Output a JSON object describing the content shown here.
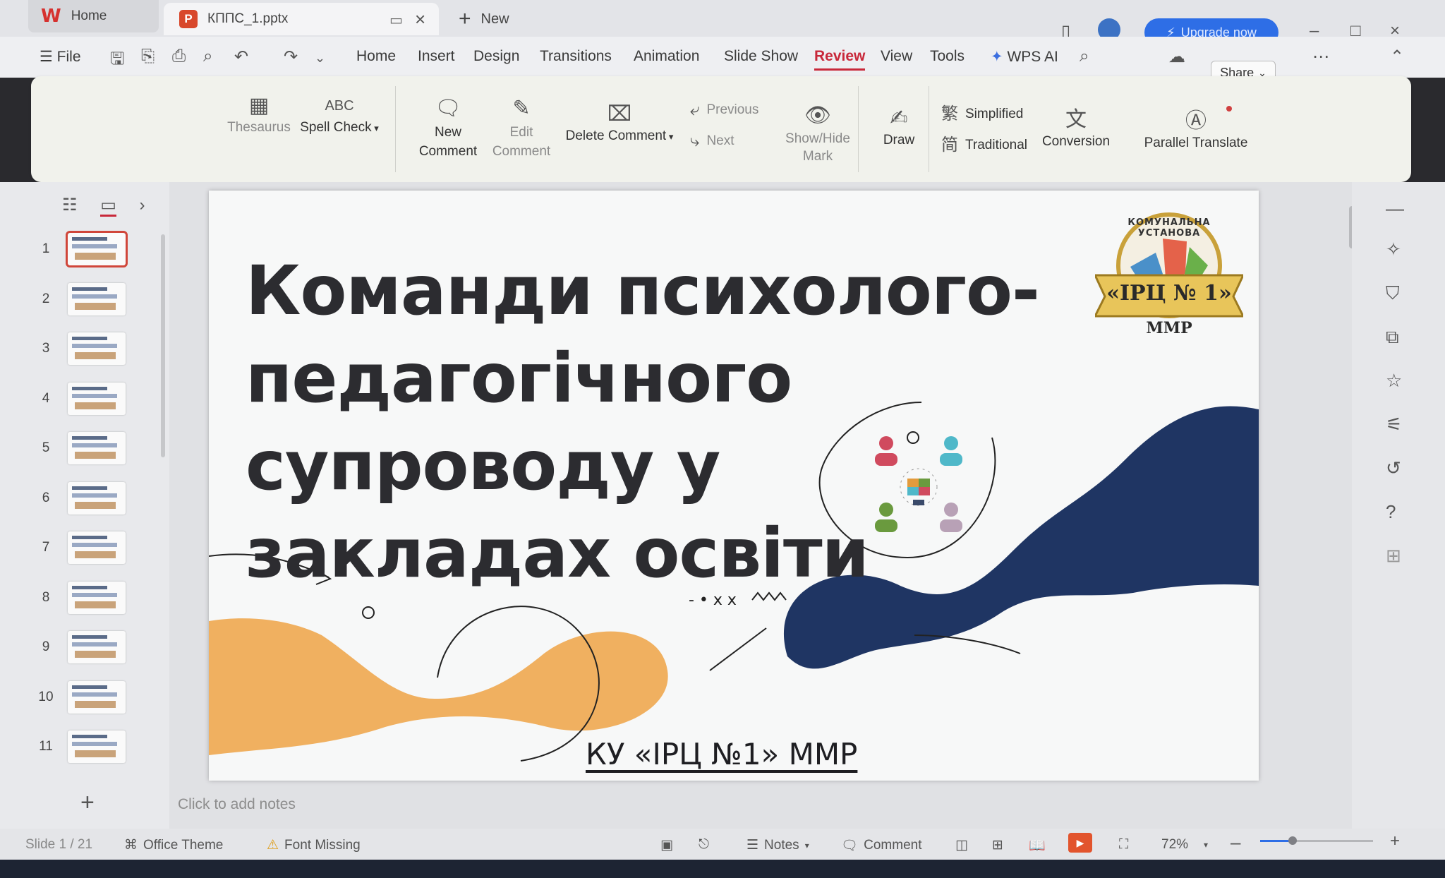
{
  "tabs": {
    "home_label": "Home",
    "doc_label": "КППС_1.pptx",
    "new_label": "New",
    "upgrade_label": "Upgrade now"
  },
  "menu": {
    "file_label": "File",
    "items": [
      "Home",
      "Insert",
      "Design",
      "Transitions",
      "Animation",
      "Slide Show",
      "Review",
      "View",
      "Tools"
    ],
    "active": "Review",
    "wps_ai_label": "WPS AI",
    "share_label": "Share"
  },
  "ribbon": {
    "thesaurus": "Thesaurus",
    "spell_check": "Spell Check",
    "new_comment": [
      "New",
      "Comment"
    ],
    "edit_comment": [
      "Edit",
      "Comment"
    ],
    "delete_comment": "Delete Comment",
    "previous": "Previous",
    "next": "Next",
    "show_hide_mark": [
      "Show/Hide",
      "Mark"
    ],
    "draw": "Draw",
    "simplified": "Simplified",
    "traditional": "Traditional",
    "conversion": "Conversion",
    "parallel_translate": "Parallel Translate",
    "spell_icon_text": "ABC"
  },
  "slides_panel": {
    "numbers": [
      "1",
      "2",
      "3",
      "4",
      "5",
      "6",
      "7",
      "8",
      "9",
      "10",
      "11"
    ],
    "selected": 1
  },
  "slide": {
    "title_lines": [
      "Команди психолого-",
      "педагогічного супроводу у",
      "закладах освіти"
    ],
    "footer": "КУ «ІРЦ №1» ММР",
    "logo_top_text": "КОМУНАЛЬНА УСТАНОВА",
    "logo_center_text": "«ІРЦ № 1»",
    "logo_bottom_text": "ММР",
    "doodle_text": "- • x x",
    "colors": {
      "orange": "#f0b060",
      "navy": "#1f3563",
      "title": "#2c2c30"
    }
  },
  "notes_placeholder": "Click to add notes",
  "status": {
    "slide_counter": "Slide 1 / 21",
    "theme": "Office Theme",
    "font_missing": "Font Missing",
    "notes_label": "Notes",
    "comment_label": "Comment",
    "zoom": "72%",
    "zoom_fraction": 0.29
  },
  "icons": {
    "tab_bar": [
      "wps-logo-icon",
      "ppt-file-icon",
      "monitor-icon",
      "close-icon",
      "plus-icon",
      "tablet-icon",
      "avatar-icon",
      "bolt-icon",
      "minimize-icon",
      "maximize-icon",
      "window-close-icon"
    ],
    "right_sidebar": [
      "minus-icon",
      "magic-icon",
      "shirt-icon",
      "transform-icon",
      "star-icon",
      "sliders-icon",
      "history-icon",
      "help-icon",
      "grid-icon"
    ]
  }
}
